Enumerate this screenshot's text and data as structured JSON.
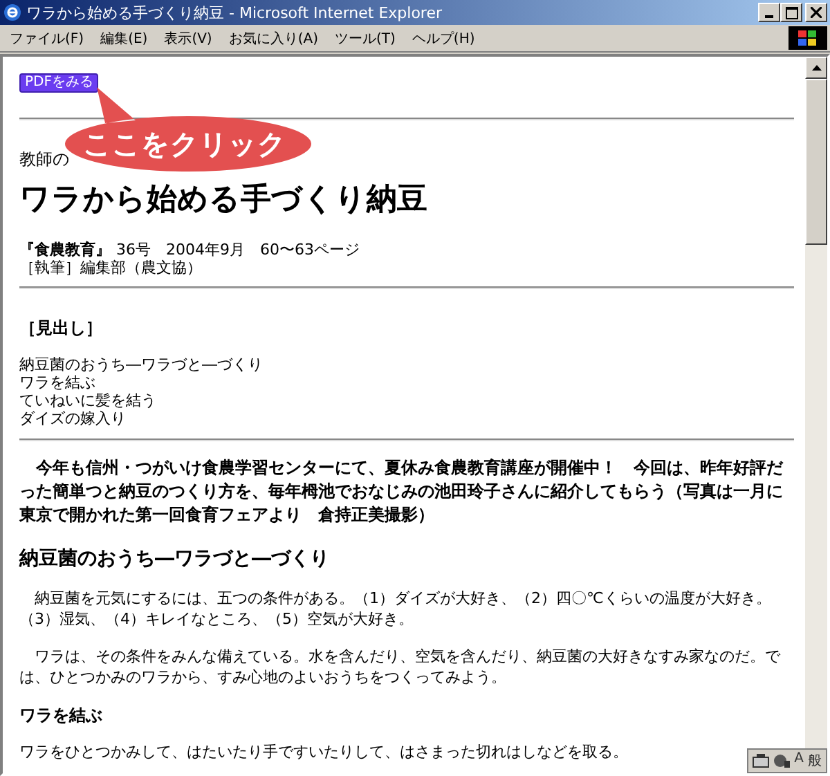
{
  "window": {
    "title": "ワラから始める手づくり納豆 - Microsoft Internet Explorer"
  },
  "menu": [
    "ファイル(F)",
    "編集(E)",
    "表示(V)",
    "お気に入り(A)",
    "ツール(T)",
    "ヘルプ(H)"
  ],
  "pdf_button": {
    "label": "PDFをみる"
  },
  "callout": {
    "text": "ここをクリック"
  },
  "article": {
    "category": "教師の",
    "title": "ワラから始める手づくり納豆",
    "source": {
      "magazine": "『食農教育』",
      "details": "36号　2004年9月　60〜63ページ"
    },
    "author": "［執筆］編集部（農文協）",
    "headings_label": "［見出し］",
    "headings": [
      "納豆菌のおうち―ワラづと―づくり",
      "ワラを結ぶ",
      "ていねいに髪を結う",
      "ダイズの嫁入り"
    ],
    "blocks": [
      {
        "kind": "lead",
        "text": "　今年も信州・つがいけ食農学習センターにて、夏休み食農教育講座が開催中！　今回は、昨年好評だった簡単つと納豆のつくり方を、毎年栂池でおなじみの池田玲子さんに紹介してもらう（写真は一月に東京で開かれた第一回食育フェアより　倉持正美撮影）"
      },
      {
        "kind": "heading",
        "text": "納豆菌のおうち―ワラづと―づくり"
      },
      {
        "kind": "para",
        "text": "　納豆菌を元気にするには、五つの条件がある。（1）ダイズが大好き、（2）四〇℃くらいの温度が大好き。（3）湿気、（4）キレイなところ、（5）空気が大好き。"
      },
      {
        "kind": "para",
        "text": "　ワラは、その条件をみんな備えている。水を含んだり、空気を含んだり、納豆菌の大好きなすみ家なのだ。では、ひとつかみのワラから、すみ心地のよいおうちをつくってみよう。"
      },
      {
        "kind": "subheading",
        "text": "ワラを結ぶ"
      },
      {
        "kind": "para",
        "text": "ワラをひとつかみして、はたいたり手ですいたりして、はさまった切れはしなどを取る。"
      }
    ]
  },
  "ime_bar": {
    "labels": [
      "A",
      "般"
    ]
  }
}
